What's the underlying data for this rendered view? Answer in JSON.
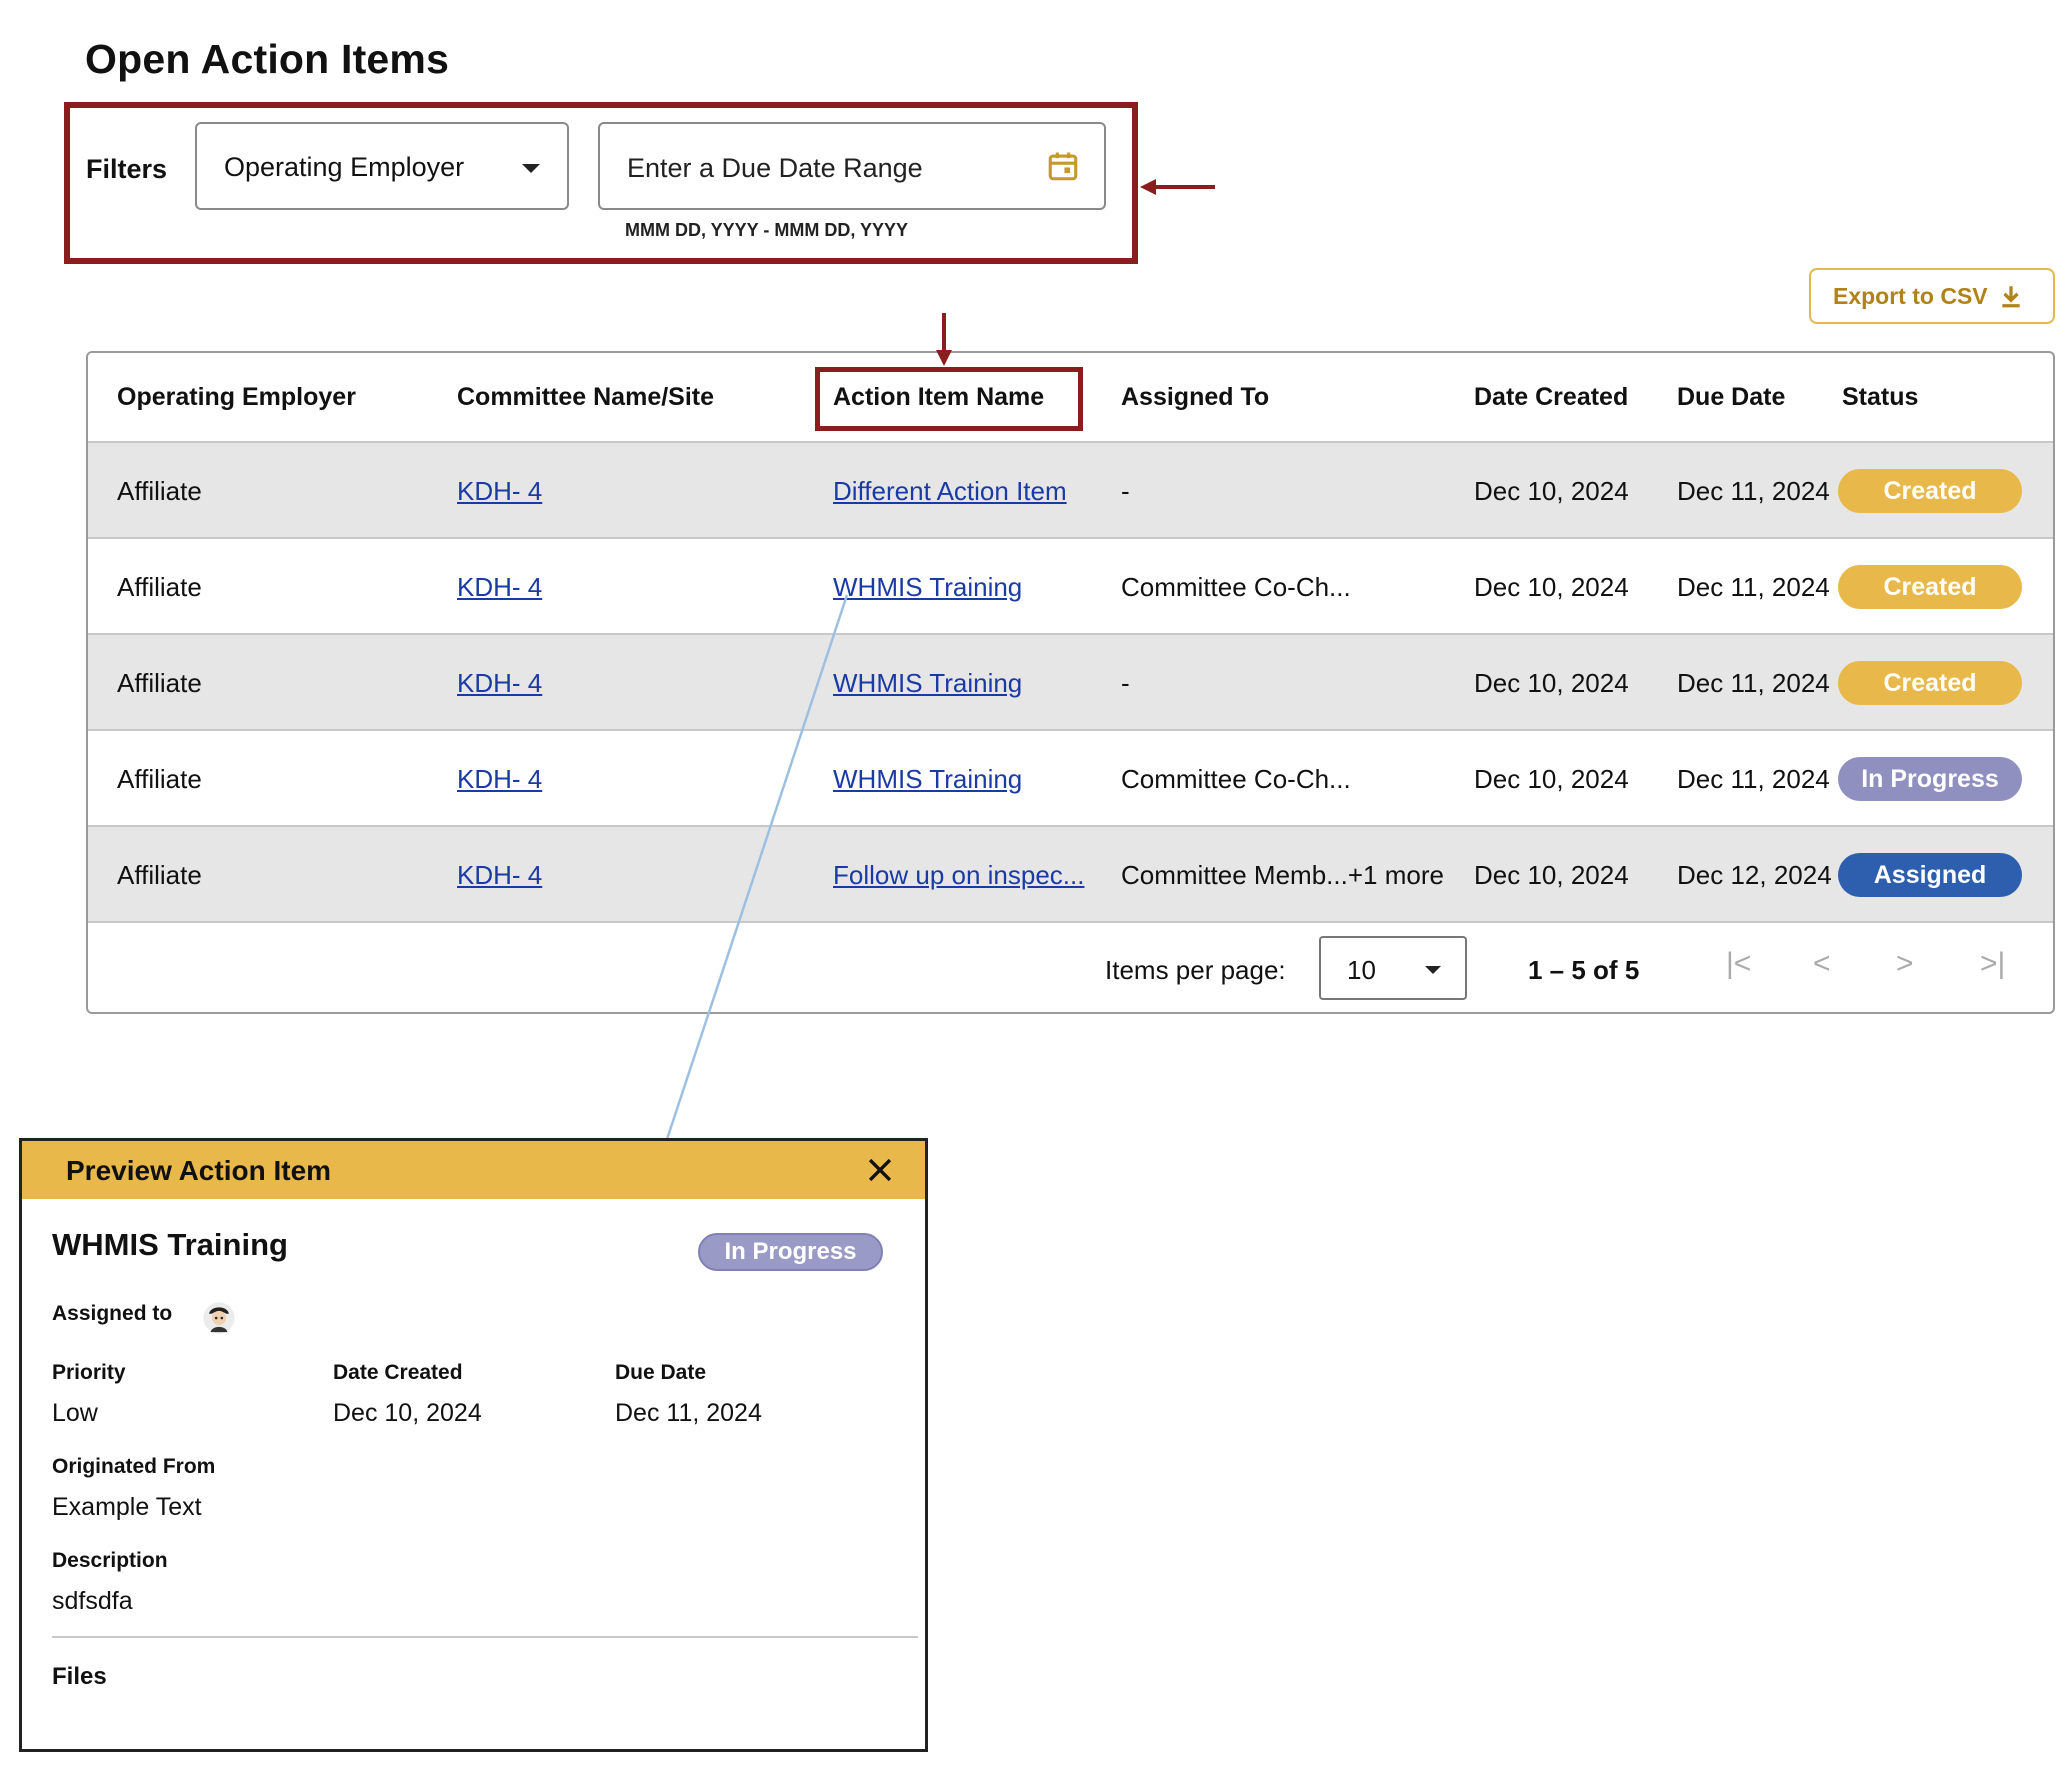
{
  "page": {
    "title": "Open Action Items"
  },
  "filters": {
    "label": "Filters",
    "employer_select": "Operating Employer",
    "date_placeholder": "Enter a Due Date Range",
    "date_hint": "MMM DD, YYYY - MMM DD, YYYY"
  },
  "export": {
    "label": "Export to CSV",
    "icon": "download-icon"
  },
  "table": {
    "columns": [
      "Operating Employer",
      "Committee Name/Site",
      "Action Item Name",
      "Assigned To",
      "Date Created",
      "Due Date",
      "Status"
    ],
    "rows": [
      {
        "employer": "Affiliate",
        "committee": "KDH- 4",
        "action": "Different Action Item",
        "assigned": "-",
        "created": "Dec 10, 2024",
        "due": "Dec 11, 2024",
        "status": "Created"
      },
      {
        "employer": "Affiliate",
        "committee": "KDH- 4",
        "action": "WHMIS Training",
        "assigned": "Committee Co-Ch...",
        "created": "Dec 10, 2024",
        "due": "Dec 11, 2024",
        "status": "Created"
      },
      {
        "employer": "Affiliate",
        "committee": "KDH- 4",
        "action": "WHMIS Training",
        "assigned": "-",
        "created": "Dec 10, 2024",
        "due": "Dec 11, 2024",
        "status": "Created"
      },
      {
        "employer": "Affiliate",
        "committee": "KDH- 4",
        "action": "WHMIS Training",
        "assigned": "Committee Co-Ch...",
        "created": "Dec 10, 2024",
        "due": "Dec 11, 2024",
        "status": "In Progress"
      },
      {
        "employer": "Affiliate",
        "committee": "KDH- 4",
        "action": "Follow up on inspec...",
        "assigned": "Committee Memb...+1 more",
        "created": "Dec 10, 2024",
        "due": "Dec 12, 2024",
        "status": "Assigned"
      }
    ],
    "pagination": {
      "items_per_page_label": "Items per page:",
      "items_per_page": "10",
      "range": "1 – 5 of 5",
      "first": "|<",
      "prev": "<",
      "next": ">",
      "last": ">|"
    }
  },
  "status_colors": {
    "Created": "#e8b84a",
    "In Progress": "#8f8fc0",
    "Assigned": "#2e5fae"
  },
  "highlight_color": "#8a1d1d",
  "preview": {
    "header": "Preview Action Item",
    "title": "WHMIS Training",
    "status": "In Progress",
    "assigned_label": "Assigned to",
    "priority_label": "Priority",
    "priority": "Low",
    "date_created_label": "Date Created",
    "date_created": "Dec 10, 2024",
    "due_date_label": "Due Date",
    "due_date": "Dec 11, 2024",
    "originated_label": "Originated From",
    "originated": "Example Text",
    "description_label": "Description",
    "description": "sdfsdfa",
    "files_label": "Files"
  }
}
